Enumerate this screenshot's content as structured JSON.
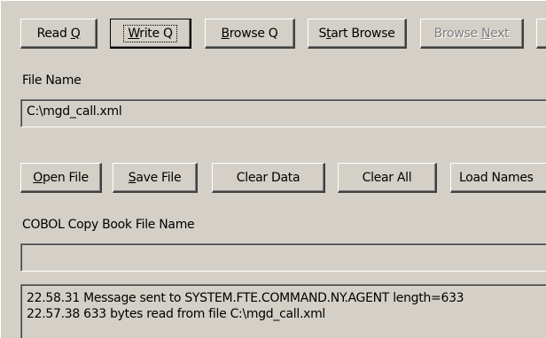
{
  "toolbar1": {
    "read_q": {
      "pre": "Read ",
      "key": "Q",
      "post": ""
    },
    "write_q": {
      "pre": "",
      "key": "W",
      "post": "rite Q"
    },
    "browse_q": {
      "pre": "",
      "key": "B",
      "post": "rowse Q"
    },
    "start_browse": {
      "pre": "S",
      "key": "t",
      "post": "art Browse"
    },
    "browse_next": {
      "pre": "Browse ",
      "key": "N",
      "post": "ext"
    }
  },
  "file_name": {
    "label": "File Name",
    "value": "C:\\mgd_call.xml"
  },
  "toolbar2": {
    "open_file": {
      "pre": "",
      "key": "O",
      "post": "pen File"
    },
    "save_file": {
      "pre": "",
      "key": "S",
      "post": "ave File"
    },
    "clear_data": "Clear Data",
    "clear_all": "Clear All",
    "load_names": "Load Names"
  },
  "cobol": {
    "label": "COBOL Copy Book File Name",
    "value": ""
  },
  "log": {
    "lines": [
      "22.58.31 Message sent to SYSTEM.FTE.COMMAND.NY.AGENT length=633",
      "22.57.38 633 bytes read from file C:\\mgd_call.xml"
    ]
  }
}
